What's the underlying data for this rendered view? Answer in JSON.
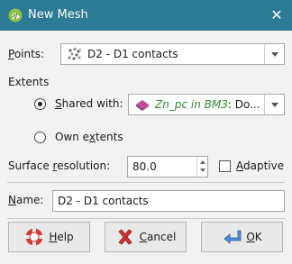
{
  "window": {
    "title": "New Mesh",
    "close_glyph": "✕",
    "icon": "mesh-app-icon"
  },
  "points": {
    "label_u": "P",
    "label_rest": "oints:",
    "value": "D2 - D1 contacts",
    "icon": "points-icon"
  },
  "extents": {
    "heading": "Extents",
    "shared": {
      "label_u": "S",
      "label_rest": "hared with:",
      "selected": true,
      "value_italic": "Zn_pc in BM3",
      "value_rest": ": Do...",
      "icon": "block-model-icon",
      "value_color": "#2f8a2f"
    },
    "own": {
      "label_pre": "Own e",
      "label_u": "x",
      "label_post": "tents",
      "selected": false
    }
  },
  "resolution": {
    "label_pre": "Surface ",
    "label_u": "r",
    "label_post": "esolution:",
    "value": "80.0"
  },
  "adaptive": {
    "label_u": "A",
    "label_rest": "daptive",
    "checked": false
  },
  "name": {
    "label_u": "N",
    "label_rest": "ame:",
    "value": "D2 - D1 contacts"
  },
  "buttons": {
    "help": {
      "label_u": "H",
      "label_rest": "elp",
      "icon": "help-icon"
    },
    "cancel": {
      "label_u": "C",
      "label_rest": "ancel",
      "icon": "cancel-icon"
    },
    "ok": {
      "label_u": "O",
      "label_rest": "K",
      "icon": "ok-icon"
    }
  }
}
